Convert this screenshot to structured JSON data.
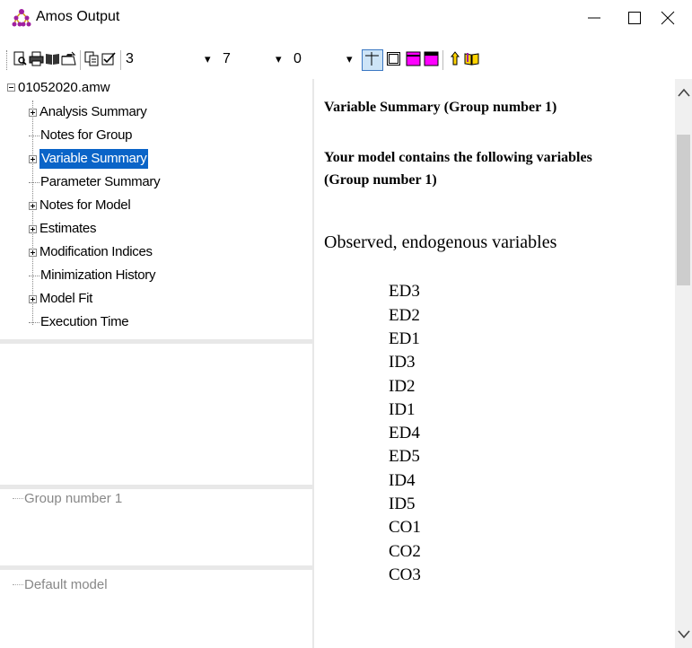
{
  "window": {
    "title": "Amos Output",
    "icon": "amos-network-icon"
  },
  "toolbar": {
    "icons": [
      "print-preview-icon",
      "print-icon",
      "book-icon",
      "open-folder-icon",
      "copy-icon",
      "checkbox-icon"
    ],
    "decimals": "3",
    "column_spacing": "7",
    "table_rotation": "0",
    "view_icons": [
      "grid-lines-icon",
      "table-borders-icon",
      "magenta-table-icon",
      "magenta-window-icon",
      "pointer-up-icon",
      "help-book-icon"
    ]
  },
  "tree": {
    "root": "01052020.amw",
    "items": [
      {
        "label": "Analysis Summary",
        "expandable": true
      },
      {
        "label": "Notes for Group",
        "expandable": false
      },
      {
        "label": "Variable Summary",
        "expandable": true,
        "selected": true
      },
      {
        "label": "Parameter Summary",
        "expandable": false
      },
      {
        "label": "Notes for Model",
        "expandable": true
      },
      {
        "label": "Estimates",
        "expandable": true
      },
      {
        "label": "Modification Indices",
        "expandable": true
      },
      {
        "label": "Minimization History",
        "expandable": false
      },
      {
        "label": "Model Fit",
        "expandable": true
      },
      {
        "label": "Execution Time",
        "expandable": false
      }
    ]
  },
  "groups": {
    "label": "Group number 1"
  },
  "models": {
    "label": "Default model"
  },
  "content": {
    "heading": "Variable Summary (Group number 1)",
    "subheading_line1": "Your model contains the following variables",
    "subheading_line2": "(Group number 1)",
    "section_title": "Observed, endogenous variables",
    "variables": [
      "ED3",
      "ED2",
      "ED1",
      "ID3",
      "ID2",
      "ID1",
      "ED4",
      "ED5",
      "ID4",
      "ID5",
      "CO1",
      "CO2",
      "CO3"
    ]
  },
  "colors": {
    "selection": "#0a64c8",
    "magenta": "#ff00ff",
    "active_button": "#cde4f7"
  }
}
